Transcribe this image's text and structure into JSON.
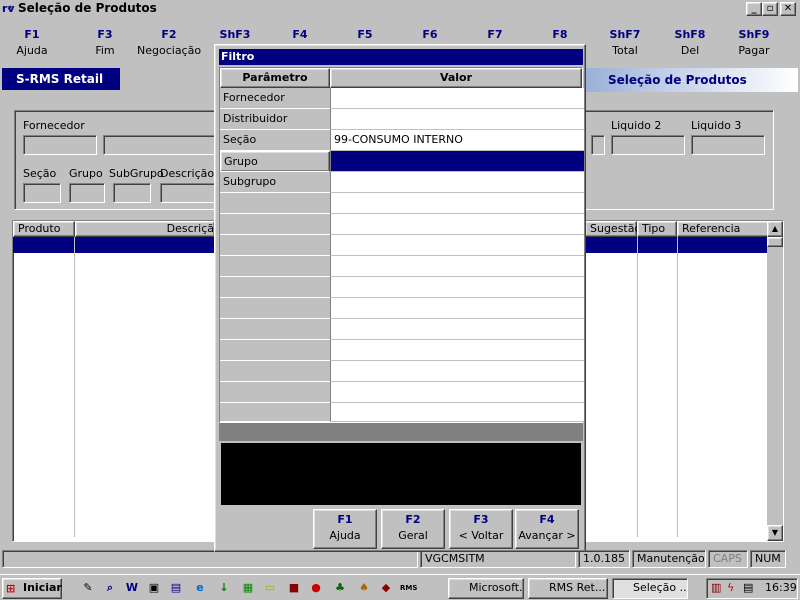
{
  "window": {
    "title": "Seleção de Produtos",
    "min": "_",
    "max": "▫",
    "close": "✕"
  },
  "fkeys": [
    {
      "key": "F1",
      "label": "Ajuda"
    },
    {
      "key": "F3",
      "label": "Fim"
    },
    {
      "key": "F2",
      "label": "Negociação"
    },
    {
      "key": "ShF3",
      "label": ""
    },
    {
      "key": "F4",
      "label": ""
    },
    {
      "key": "F5",
      "label": ""
    },
    {
      "key": "F6",
      "label": ""
    },
    {
      "key": "F7",
      "label": ""
    },
    {
      "key": "F8",
      "label": ""
    },
    {
      "key": "ShF7",
      "label": "Total"
    },
    {
      "key": "ShF8",
      "label": "Del"
    },
    {
      "key": "ShF9",
      "label": "Pagar"
    }
  ],
  "banner": {
    "left": "S-RMS Retail",
    "right": "Seleção de Produtos"
  },
  "filters": {
    "fornecedor": "Fornecedor",
    "liquido2": "Liquido 2",
    "liquido3": "Liquido 3",
    "secao": "Seção",
    "grupo": "Grupo",
    "subgrupo": "SubGrupo",
    "descricao": "Descrição d"
  },
  "grid": {
    "headers": [
      "Produto",
      "Descriçã",
      "Sugestão",
      "Tipo",
      "Referencia"
    ]
  },
  "status": {
    "s1": "",
    "s2": "",
    "s3": "VGCMSITM",
    "s4": "1.0.185",
    "s5": "Manutenção",
    "s6": "CAPS",
    "s7": "NUM"
  },
  "taskbar": {
    "start": "Iniciar",
    "tasks": [
      "Microsoft...",
      "RMS Ret...",
      "Seleção ..."
    ],
    "clock": "16:39"
  },
  "dialog": {
    "title": "Filtro",
    "col_param": "Parâmetro",
    "col_valor": "Valor",
    "rows": [
      {
        "param": "Fornecedor",
        "valor": ""
      },
      {
        "param": "Distribuidor",
        "valor": ""
      },
      {
        "param": "Seção",
        "valor": "99-CONSUMO INTERNO"
      },
      {
        "param": "Grupo",
        "valor": ""
      },
      {
        "param": "Subgrupo",
        "valor": ""
      }
    ],
    "buttons": [
      {
        "key": "F1",
        "label": "Ajuda"
      },
      {
        "key": "F2",
        "label": "Geral"
      },
      {
        "key": "F3",
        "label": "< Voltar"
      },
      {
        "key": "F4",
        "label": "Avançar >"
      }
    ]
  },
  "colors": {
    "accent": "#000080",
    "face": "#c0c0c0"
  }
}
